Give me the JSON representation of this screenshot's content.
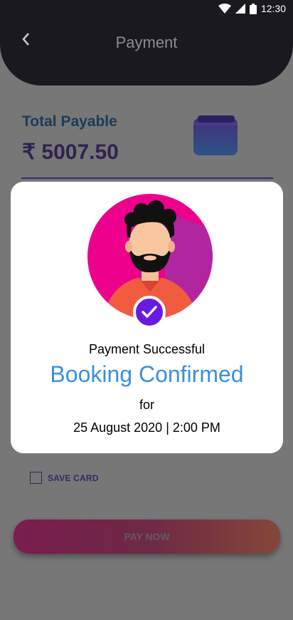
{
  "status_bar": {
    "time": "12:30",
    "icons": [
      "wifi-icon",
      "signal-icon",
      "battery-icon"
    ]
  },
  "header": {
    "title": "Payment",
    "back_icon": "chevron-left-icon"
  },
  "summary": {
    "total_label": "Total Payable",
    "amount": "₹ 5007.50",
    "wallet_icon": "wallet-icon"
  },
  "save_card": {
    "label": "SAVE CARD",
    "checked": false
  },
  "pay_button": {
    "label": "PAY NOW"
  },
  "modal": {
    "status": "Payment Successful",
    "headline": "Booking Confirmed",
    "for_label": "for",
    "datetime": "25 August 2020 | 2:00 PM",
    "check_icon": "check-icon"
  },
  "colors": {
    "header_bg": "#1a1920",
    "overlay_bg": "#777777",
    "headline_blue": "#3b90d8",
    "check_purple": "#6a1ae0",
    "avatar_pink": "#ec008c"
  }
}
